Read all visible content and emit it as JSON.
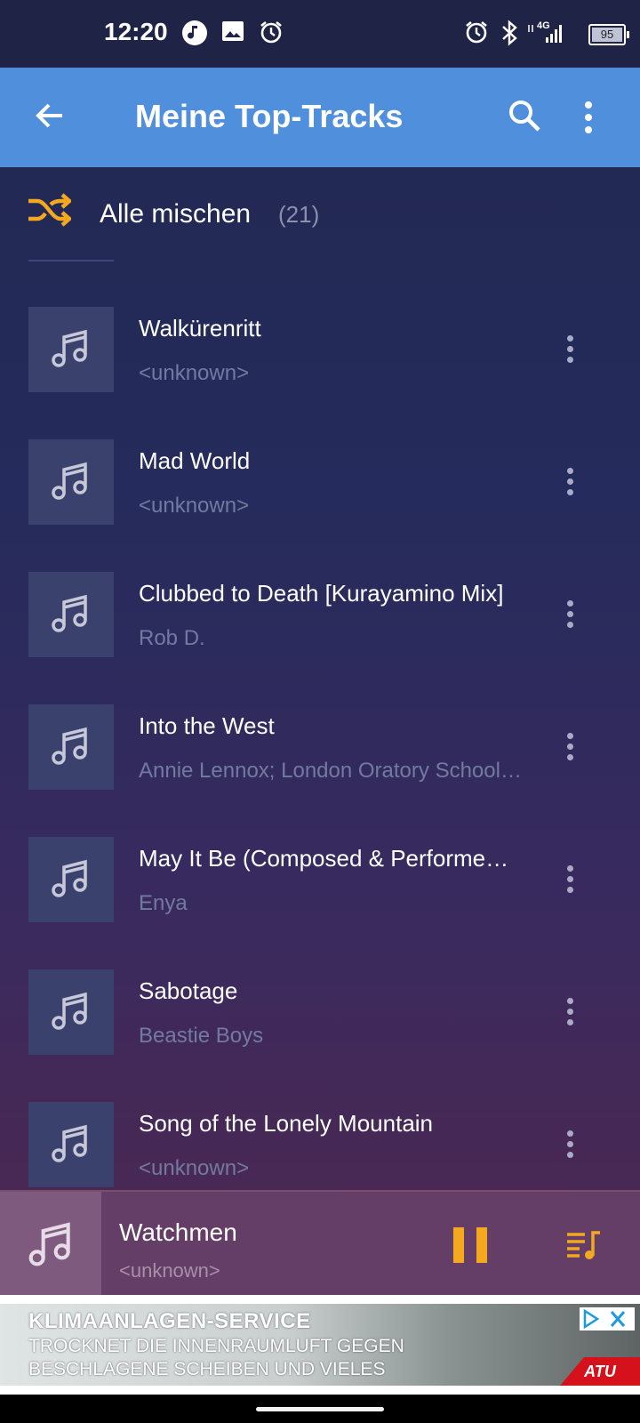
{
  "status_bar": {
    "time": "12:20",
    "battery": "95",
    "network": "4G",
    "left_icons": [
      "music-note-icon",
      "image-icon",
      "alarm-icon"
    ],
    "right_icons": [
      "alarm-icon",
      "bluetooth-icon",
      "signal-icon",
      "battery-icon"
    ]
  },
  "app_bar": {
    "title": "Meine Top-Tracks",
    "icons": [
      "back-arrow-icon",
      "search-icon",
      "more-vert-icon"
    ]
  },
  "shuffle": {
    "label": "Alle mischen",
    "count": "(21)",
    "accent": "#f4a81f"
  },
  "tracks": [
    {
      "title": "Walkürenritt",
      "subtitle": "<unknown>"
    },
    {
      "title": "Mad World",
      "subtitle": "<unknown>"
    },
    {
      "title": "Clubbed to Death [Kurayamino Mix]",
      "subtitle": "Rob D."
    },
    {
      "title": "Into the West",
      "subtitle": "Annie Lennox; London Oratory School…"
    },
    {
      "title": "May It Be (Composed & Performe…",
      "subtitle": "Enya"
    },
    {
      "title": "Sabotage",
      "subtitle": "Beastie Boys"
    },
    {
      "title": "Song of the Lonely Mountain",
      "subtitle": "<unknown>"
    }
  ],
  "now_playing": {
    "title": "Watchmen",
    "subtitle": "<unknown>"
  },
  "ad": {
    "headline": "KLIMAANLAGEN-SERVICE",
    "line1": "TROCKNET DIE INNENRAUMLUFT GEGEN",
    "line2": "BESCHLAGENE SCHEIBEN UND VIELES",
    "brand": "ATU"
  },
  "colors": {
    "app_bar": "#4f8fdb",
    "accent": "#f4a81f",
    "background": "#252b5c"
  }
}
